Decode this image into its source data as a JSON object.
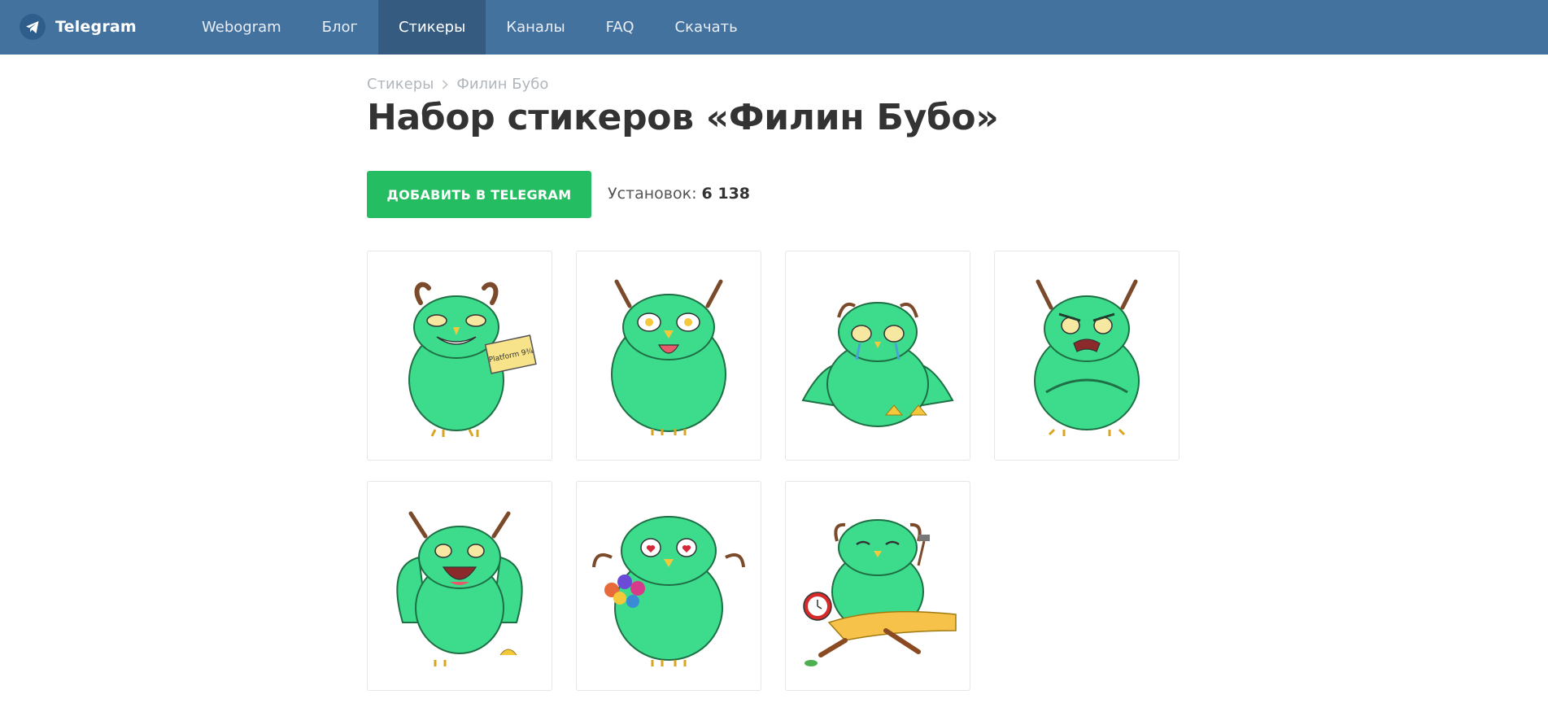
{
  "brand": {
    "name": "Telegram",
    "icon": "paper-plane-icon"
  },
  "nav": {
    "items": [
      {
        "label": "Webogram",
        "active": false
      },
      {
        "label": "Блог",
        "active": false
      },
      {
        "label": "Стикеры",
        "active": true
      },
      {
        "label": "Каналы",
        "active": false
      },
      {
        "label": "FAQ",
        "active": false
      },
      {
        "label": "Скачать",
        "active": false
      }
    ]
  },
  "breadcrumb": {
    "parent": "Стикеры",
    "current": "Филин Бубо",
    "separator_icon": "chevron-right-icon"
  },
  "page": {
    "title": "Набор стикеров «Филин Бубо»",
    "add_button": "ДОБАВИТЬ В TELEGRAM",
    "installs_label": "Установок:",
    "installs_value": "6 138"
  },
  "stickers": {
    "items": [
      {
        "name": "owl-with-sign",
        "sign_text": "Platform 9¾"
      },
      {
        "name": "owl-tongue-out"
      },
      {
        "name": "owl-crying"
      },
      {
        "name": "owl-angry"
      },
      {
        "name": "owl-laughing"
      },
      {
        "name": "owl-in-love-with-flowers"
      },
      {
        "name": "owl-on-branch-with-clock"
      }
    ]
  },
  "colors": {
    "header": "#44729f",
    "header_active": "#365b80",
    "add_button": "#25bd61",
    "owl_green": "#3ddc8c",
    "owl_dark": "#1f9e5f"
  }
}
